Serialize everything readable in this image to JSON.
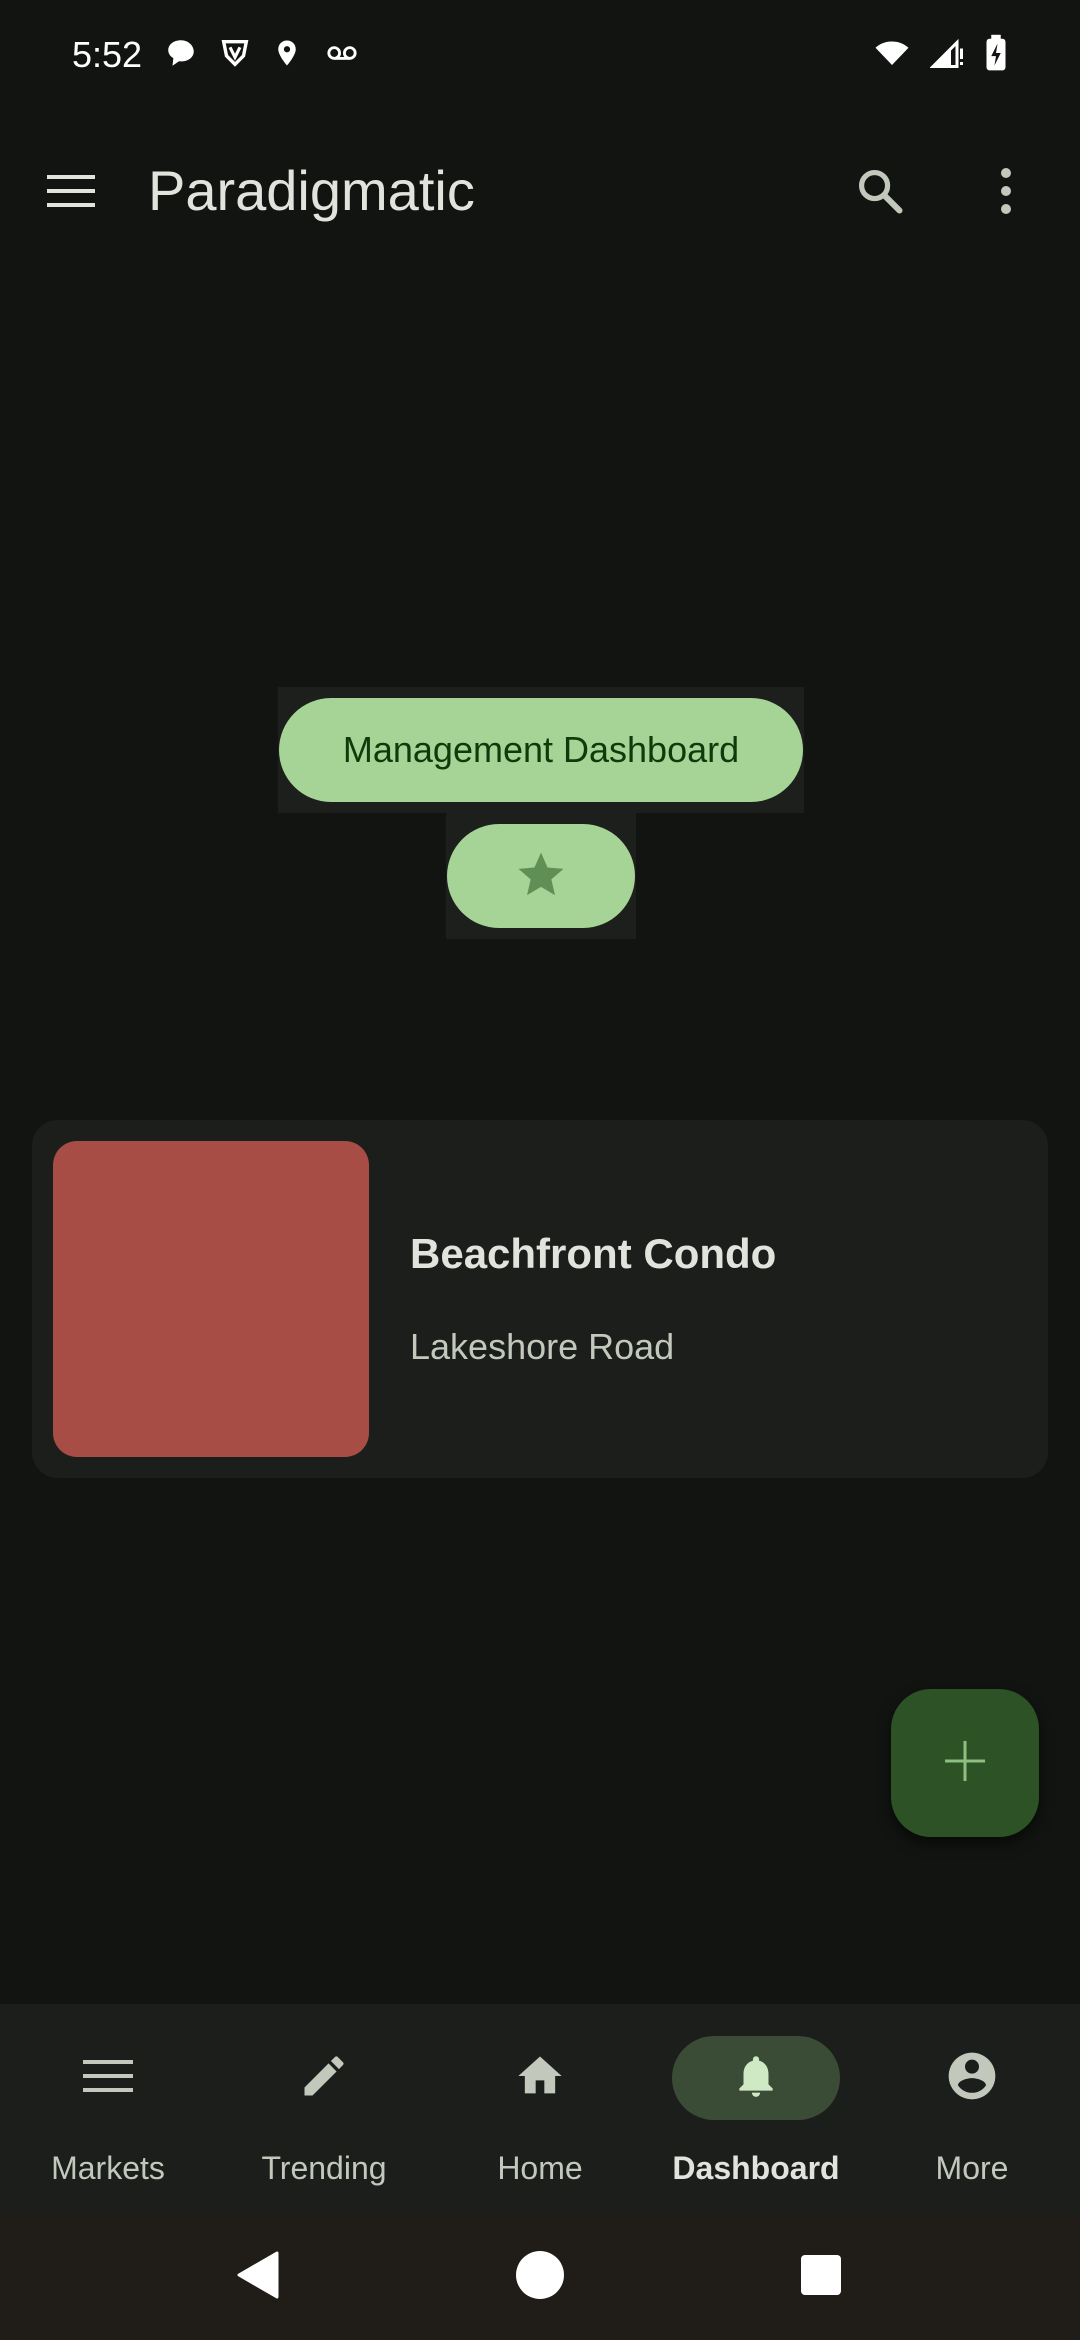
{
  "status_bar": {
    "time": "5:52",
    "left_icons": [
      "chat-bubble-icon",
      "shield-v-icon",
      "location-pin-icon",
      "voicemail-icon"
    ],
    "right_icons": [
      "wifi-icon",
      "cell-signal-icon",
      "battery-charging-icon"
    ]
  },
  "top_bar": {
    "title": "Paradigmatic",
    "icons": [
      "menu-icon",
      "search-icon",
      "more-vert-icon"
    ]
  },
  "main": {
    "primary_button_label": "Management Dashboard",
    "star_button_icon": "star-icon"
  },
  "card": {
    "title": "Beachfront Condo",
    "subtitle": "Lakeshore Road",
    "image_color": "#a84c46"
  },
  "fab": {
    "icon": "plus-icon"
  },
  "bottom_nav": {
    "items": [
      {
        "label": "Markets",
        "icon": "lines-icon",
        "active": false
      },
      {
        "label": "Trending",
        "icon": "pencil-icon",
        "active": false
      },
      {
        "label": "Home",
        "icon": "home-icon",
        "active": false
      },
      {
        "label": "Dashboard",
        "icon": "bell-icon",
        "active": true
      },
      {
        "label": "More",
        "icon": "account-circle-icon",
        "active": false
      }
    ]
  },
  "colors": {
    "background": "#121411",
    "accent": "#a6d396",
    "fab": "#2d5225",
    "nav_indicator": "#3a4b36"
  }
}
